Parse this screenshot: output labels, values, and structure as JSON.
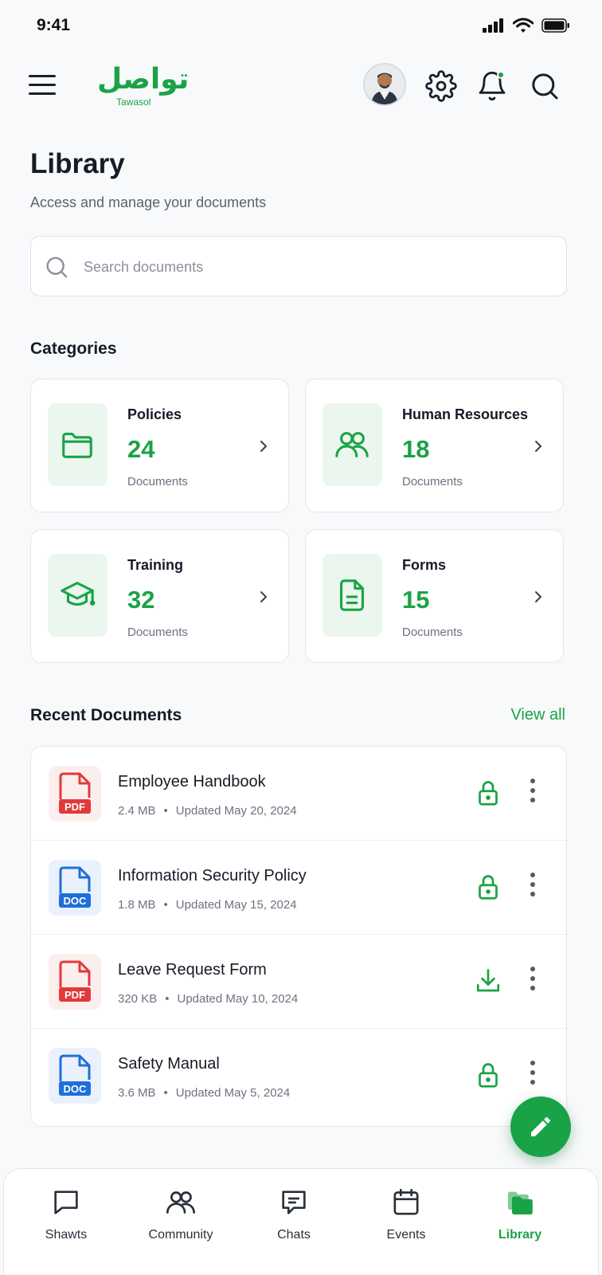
{
  "status_bar": {
    "time": "9:41"
  },
  "header": {
    "brand_arabic": "تواصل",
    "brand_latin": "Tawasol",
    "accent_color": "#1aa346"
  },
  "page": {
    "title": "Library",
    "subtitle": "Access and manage your documents"
  },
  "search": {
    "placeholder": "Search documents",
    "value": ""
  },
  "categories": {
    "heading": "Categories",
    "items": [
      {
        "name": "Policies",
        "count": "24",
        "unit": "Documents",
        "icon": "folder-icon"
      },
      {
        "name": "Human Resources",
        "count": "18",
        "unit": "Documents",
        "icon": "users-icon"
      },
      {
        "name": "Training",
        "count": "32",
        "unit": "Documents",
        "icon": "graduation-cap-icon"
      },
      {
        "name": "Forms",
        "count": "15",
        "unit": "Documents",
        "icon": "file-text-icon"
      }
    ]
  },
  "recent": {
    "heading": "Recent Documents",
    "view_all": "View all",
    "documents": [
      {
        "name": "Employee Handbook",
        "type": "PDF",
        "size": "2.4 MB",
        "updated": "Updated May 20, 2024",
        "action": "lock-icon"
      },
      {
        "name": "Information Security Policy",
        "type": "DOC",
        "size": "1.8 MB",
        "updated": "Updated May 15, 2024",
        "action": "lock-icon"
      },
      {
        "name": "Leave Request Form",
        "type": "PDF",
        "size": "320 KB",
        "updated": "Updated May 10, 2024",
        "action": "download-icon"
      },
      {
        "name": "Safety Manual",
        "type": "DOC",
        "size": "3.6 MB",
        "updated": "Updated May 5, 2024",
        "action": "lock-icon"
      }
    ]
  },
  "bottom_nav": {
    "items": [
      {
        "label": "Shawts",
        "icon": "message-square-icon",
        "active": false
      },
      {
        "label": "Community",
        "icon": "users-icon",
        "active": false
      },
      {
        "label": "Chats",
        "icon": "chat-icon",
        "active": false
      },
      {
        "label": "Events",
        "icon": "calendar-icon",
        "active": false
      },
      {
        "label": "Library",
        "icon": "library-icon",
        "active": true
      }
    ]
  }
}
